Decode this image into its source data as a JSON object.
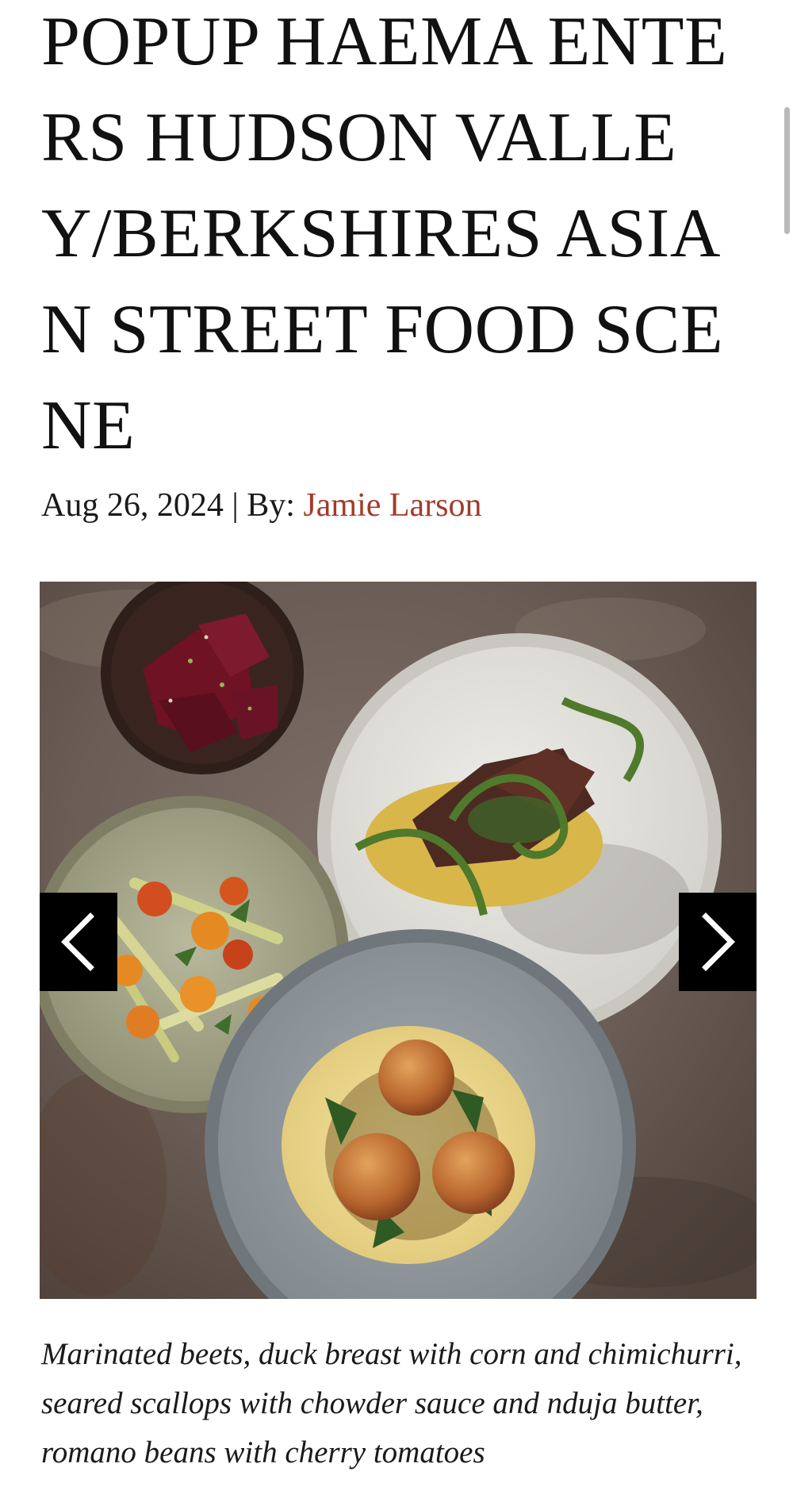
{
  "article": {
    "title": "POPUP HAEMA ENTERS HUDSON VALLEY/BERKSHIRES ASIAN STREET FOOD SCENE",
    "date": "Aug 26, 2024",
    "separator": " | By: ",
    "author": "Jamie Larson"
  },
  "carousel": {
    "image_alt": "Marinated beets, duck breast with corn and chimichurri, seared scallops with chowder sauce and nduja butter, romano beans with cherry tomatoes",
    "prev_icon": "chevron-left-icon",
    "next_icon": "chevron-right-icon",
    "caption": "Marinated beets, duck breast with corn and chimichurri, seared scallops with chowder sauce and nduja butter, romano beans with cherry tomatoes"
  },
  "colors": {
    "text": "#111111",
    "author_link": "#a23b2a",
    "nav_button_bg": "#000000",
    "nav_button_icon": "#ffffff",
    "scrollbar": "#b9b9b9"
  }
}
